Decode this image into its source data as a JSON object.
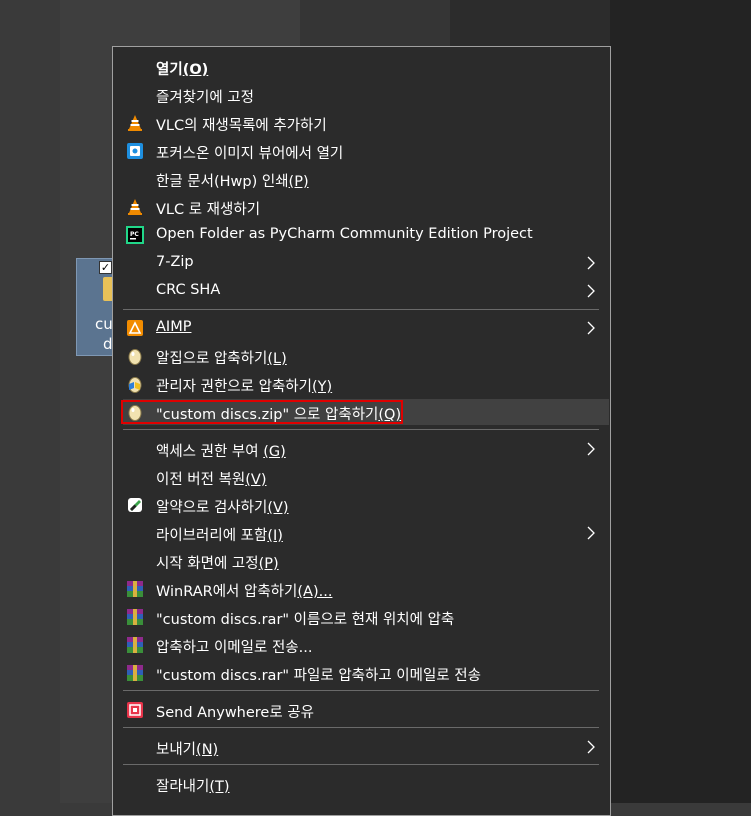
{
  "desktop": {
    "folder_label_line1": "cu",
    "folder_label_line2": "d"
  },
  "menu": {
    "items": [
      {
        "label_main": "열기",
        "accel": "(O)",
        "icon": ""
      },
      {
        "label_main": "즐겨찾기에 고정",
        "accel": "",
        "icon": ""
      },
      {
        "label_main": "VLC의 재생목록에 추가하기",
        "accel": "",
        "icon": "vlc-cone-icon"
      },
      {
        "label_main": "포커스온 이미지 뷰어에서 열기",
        "accel": "",
        "icon": "focuson-viewer-icon"
      },
      {
        "label_main": "한글 문서(Hwp) 인쇄",
        "accel": "(P)",
        "icon": ""
      },
      {
        "label_main": "VLC 로 재생하기",
        "accel": "",
        "icon": "vlc-cone-icon"
      },
      {
        "label_main": "Open Folder as PyCharm Community Edition Project",
        "accel": "",
        "icon": "pycharm-icon"
      },
      {
        "label_main": "7-Zip",
        "accel": "",
        "icon": ""
      },
      {
        "label_main": "CRC SHA",
        "accel": "",
        "icon": ""
      },
      {
        "label_main": "AIMP",
        "accel": "",
        "icon": "aimp-icon"
      },
      {
        "label_main": "알집으로 압축하기",
        "accel": "(L)",
        "icon": "alzip-egg-icon"
      },
      {
        "label_main": "관리자 권한으로 압축하기",
        "accel": "(Y)",
        "icon": "alzip-admin-icon"
      },
      {
        "label_main": "\"custom discs.zip\" 으로 압축하기",
        "accel": "(Q)",
        "icon": "alzip-egg-icon"
      },
      {
        "label_main": "액세스 권한 부여 ",
        "accel": "(G)",
        "icon": ""
      },
      {
        "label_main": "이전 버전 복원",
        "accel": "(V)",
        "icon": ""
      },
      {
        "label_main": "알약으로 검사하기",
        "accel": "(V)",
        "icon": "alyac-icon"
      },
      {
        "label_main": "라이브러리에 포함",
        "accel": "(I)",
        "icon": ""
      },
      {
        "label_main": "시작 화면에 고정",
        "accel": "(P)",
        "icon": ""
      },
      {
        "label_main": "WinRAR에서 압축하기",
        "accel": "(A)...",
        "icon": "winrar-icon"
      },
      {
        "label_main": "\"custom discs.rar\" 이름으로 현재 위치에 압축",
        "accel": "",
        "icon": "winrar-icon"
      },
      {
        "label_main": "압축하고 이메일로 전송...",
        "accel": "",
        "icon": "winrar-icon"
      },
      {
        "label_main": "\"custom discs.rar\" 파일로 압축하고 이메일로 전송",
        "accel": "",
        "icon": "winrar-icon"
      },
      {
        "label_main": "Send Anywhere로 공유",
        "accel": "",
        "icon": "send-anywhere-icon"
      },
      {
        "label_main": "보내기",
        "accel": "(N)",
        "icon": ""
      },
      {
        "label_main": "잘라내기",
        "accel": "(T)",
        "icon": ""
      }
    ]
  },
  "colors": {
    "menu_bg": "#2b2b2b",
    "menu_text": "#ffffff",
    "highlight_border": "#e00000",
    "hover_bg": "#414141"
  }
}
